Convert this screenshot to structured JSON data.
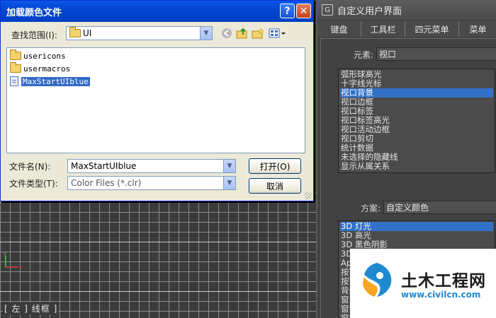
{
  "dialog": {
    "title": "加载颜色文件",
    "help_glyph": "?",
    "close_glyph": "✕",
    "look_in_label": "查找范围(I):",
    "look_in_value": "UI",
    "files": [
      {
        "name": "usericons",
        "kind": "folder",
        "selected": false
      },
      {
        "name": "usermacros",
        "kind": "folder",
        "selected": false
      },
      {
        "name": "MaxStartUIblue",
        "kind": "file",
        "selected": true
      }
    ],
    "filename_label": "文件名(N):",
    "filename_value": "MaxStartUIblue",
    "filetype_label": "文件类型(T):",
    "filetype_value": "Color Files (*.clr)",
    "open_label": "打开(O)",
    "cancel_label": "取消",
    "icons": [
      "back-arrow-icon",
      "up-folder-icon",
      "new-folder-icon",
      "view-menu-icon"
    ]
  },
  "viewport": {
    "label": "[ 左 ] 线框 ]"
  },
  "panel": {
    "title": "自定义用户界面",
    "tabs": [
      "键盘",
      "工具栏",
      "四元菜单",
      "菜单"
    ],
    "element_label": "元素:",
    "element_value": "视口",
    "elements": [
      "弧形球高光",
      "十字线光标",
      "视口背景",
      "视口边框",
      "视口标签",
      "视口标签高光",
      "视口活动边框",
      "视口剪切",
      "统计数据",
      "未选择的隐藏线",
      "显示从属关系"
    ],
    "elements_selected_index": 2,
    "scheme_label": "方案:",
    "scheme_value": "自定义颜色",
    "schemes": [
      "3D 灯光",
      "3D 高光",
      "3D 黑色阴影",
      "3D",
      "App",
      "按下",
      "按下",
      "背景",
      "窗口",
      "窗口",
      "窗口"
    ],
    "schemes_selected_index": 0
  },
  "watermark": {
    "name": "土木工程网",
    "url": "www.civilcn.com"
  },
  "colors": {
    "title_blue": "#0346d2",
    "dialog_face": "#ece9d8",
    "panel_bg": "#424242",
    "selection": "#316ac5",
    "watermark_blue": "#1f8ad0"
  }
}
